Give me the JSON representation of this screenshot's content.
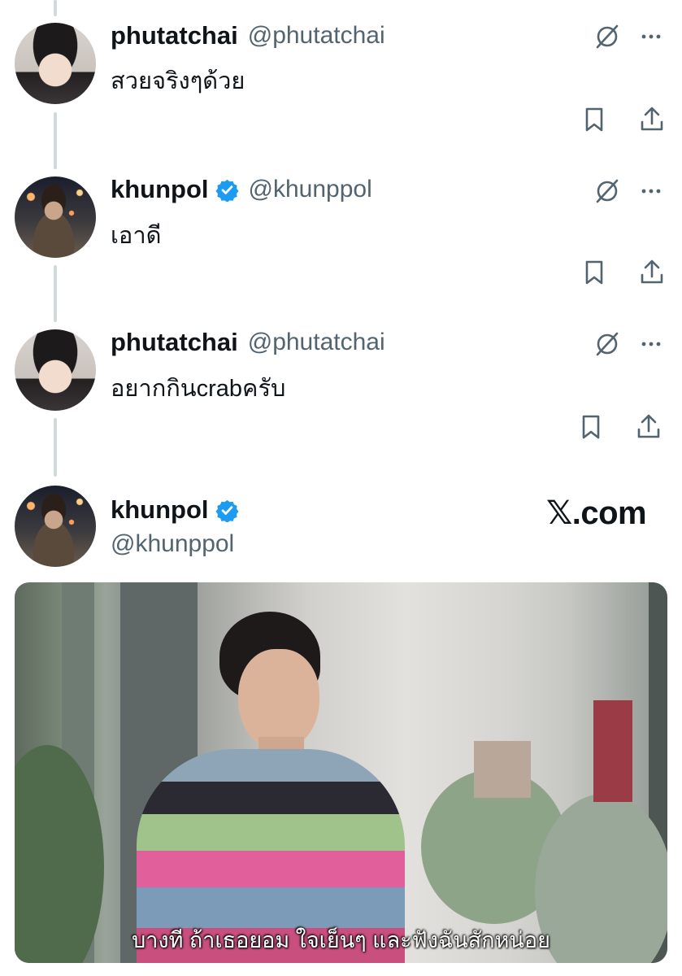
{
  "thread": [
    {
      "name": "phutatchai",
      "handle": "@phutatchai",
      "verified": false,
      "text": "สวยจริงๆด้วย"
    },
    {
      "name": "khunpol",
      "handle": "@khunppol",
      "verified": true,
      "text": "เอาดี"
    },
    {
      "name": "phutatchai",
      "handle": "@phutatchai",
      "verified": false,
      "text": "อยากกินcrabครับ"
    }
  ],
  "main_tweet": {
    "name": "khunpol",
    "handle": "@khunppol",
    "verified": true,
    "brand": "𝕏.com",
    "media_subtitle": "บางที ถ้าเธอยอม ใจเย็นๆ และฟังฉันสักหน่อย"
  },
  "icons": {
    "grok": "grok-icon",
    "more": "more-icon",
    "bookmark": "bookmark-icon",
    "share": "share-icon",
    "verified": "verified-badge-icon"
  },
  "colors": {
    "text": "#0f1419",
    "secondary": "#536471",
    "verified": "#1d9bf0",
    "thread_line": "#cfd9de"
  }
}
